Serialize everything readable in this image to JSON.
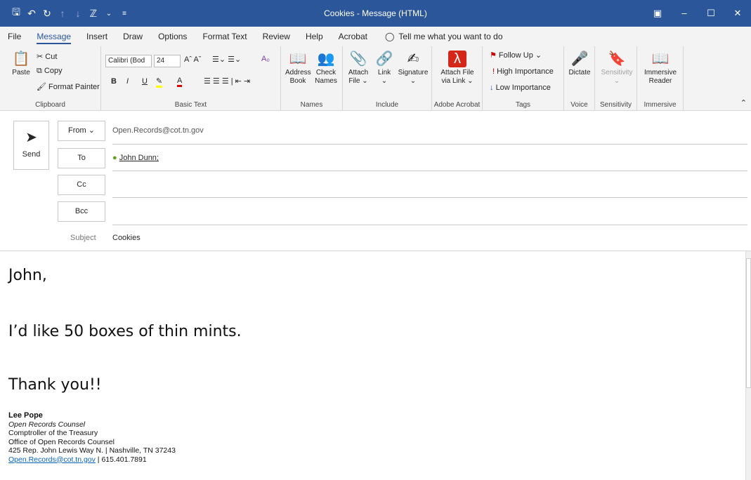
{
  "titlebar": {
    "title": "Cookies  -  Message (HTML)",
    "bg": "#2b579a",
    "qat": [
      "save-icon",
      "undo-icon",
      "redo-icon",
      "up-arrow-icon",
      "down-arrow-icon",
      "format-icon",
      "dropdown-icon",
      "customize-icon"
    ]
  },
  "tabs": [
    "File",
    "Message",
    "Insert",
    "Draw",
    "Options",
    "Format Text",
    "Review",
    "Help",
    "Acrobat"
  ],
  "tell_me": "Tell me what you want to do",
  "ribbon": {
    "clipboard": {
      "paste": "Paste",
      "cut": "Cut",
      "copy": "Copy",
      "format_painter": "Format Painter",
      "label": "Clipboard"
    },
    "basic_text": {
      "font": "Calibri (Bod",
      "size": "24",
      "label": "Basic Text",
      "bold": "B",
      "italic": "I",
      "underline": "U"
    },
    "names": {
      "address_book_1": "Address",
      "address_book_2": "Book",
      "check_names_1": "Check",
      "check_names_2": "Names",
      "label": "Names"
    },
    "include": {
      "attach": "Attach",
      "attach_2": "File",
      "link": "Link",
      "signature": "Signature",
      "label": "Include"
    },
    "adobe": {
      "attach_via_link_1": "Attach File",
      "attach_via_link_2": "via Link",
      "label": "Adobe Acrobat"
    },
    "tags": {
      "follow_up": "Follow Up",
      "high": "High Importance",
      "low": "Low Importance",
      "label": "Tags"
    },
    "voice": {
      "dictate": "Dictate",
      "label": "Voice"
    },
    "sensitivity": {
      "button": "Sensitivity",
      "label": "Sensitivity"
    },
    "immersive": {
      "reader_1": "Immersive",
      "reader_2": "Reader",
      "label": "Immersive"
    }
  },
  "compose": {
    "send": "Send",
    "from_label": "From",
    "from_value": "Open.Records@cot.tn.gov",
    "to_label": "To",
    "to_value": "John Dunn;",
    "cc_label": "Cc",
    "bcc_label": "Bcc",
    "subject_label": "Subject",
    "subject_value": "Cookies"
  },
  "body": {
    "line1": "John,",
    "line2": "I’d like 50 boxes of thin mints.",
    "line3": "Thank you!!",
    "sig_name": "Lee Pope",
    "sig_title": "Open Records Counsel",
    "sig_org1": "Comptroller of the Treasury",
    "sig_org2": "Office of Open Records Counsel",
    "sig_addr": "425 Rep. John Lewis Way N. | Nashville, TN 37243",
    "sig_email": "Open.Records@cot.tn.gov",
    "sig_phone": " | 615.401.7891"
  }
}
